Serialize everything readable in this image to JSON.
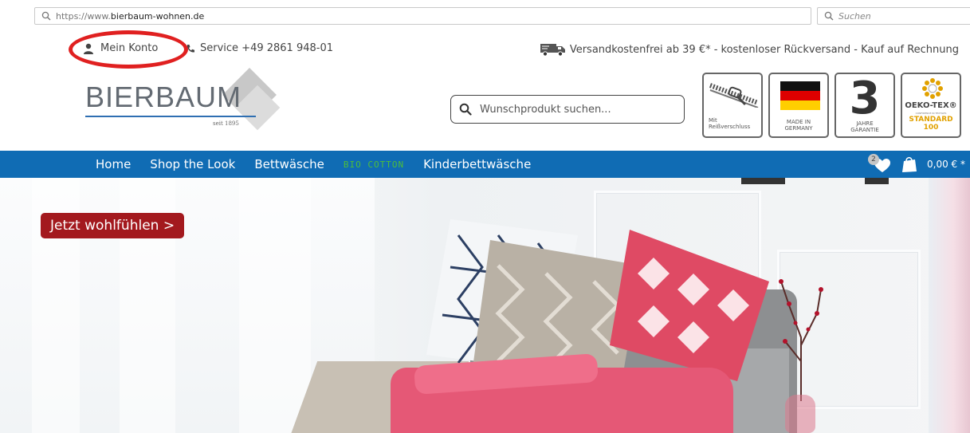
{
  "browser": {
    "url_prefix": "https://www.",
    "url_domain": "bierbaum-wohnen.de",
    "search_placeholder": "Suchen"
  },
  "topbar": {
    "account_label": "Mein Konto",
    "service_label": "Service +49 2861 948-01",
    "shipping_text": "Versandkostenfrei ab 39 €* - kostenloser Rückversand - Kauf auf Rechnung"
  },
  "logo": {
    "name": "BIERBAUM",
    "since": "seit 1895"
  },
  "product_search": {
    "placeholder": "Wunschprodukt suchen..."
  },
  "badges": {
    "zipper_line1": "Mit",
    "zipper_line2": "Reißverschluss",
    "germany_line1": "MADE IN",
    "germany_line2": "GERMANY",
    "guarantee_number": "3",
    "guarantee_line1": "JAHRE",
    "guarantee_line2": "GARANTIE",
    "oeko_title": "OEKO-TEX®",
    "oeko_sub": "CONFIDENCE IN TEXTILES",
    "oeko_standard": "STANDARD 100"
  },
  "nav": {
    "items": [
      "Home",
      "Shop the Look",
      "Bettwäsche",
      "BIO COTTON",
      "Kinderbettwäsche"
    ],
    "wishlist_count": "2",
    "cart_total": "0,00 € *"
  },
  "hero": {
    "cta_label": "Jetzt wohlfühlen >"
  },
  "colors": {
    "nav_blue": "#106cb4",
    "cta_red": "#a3191e",
    "bio_green": "#4dbd3a",
    "annotation_red": "#e02020"
  }
}
